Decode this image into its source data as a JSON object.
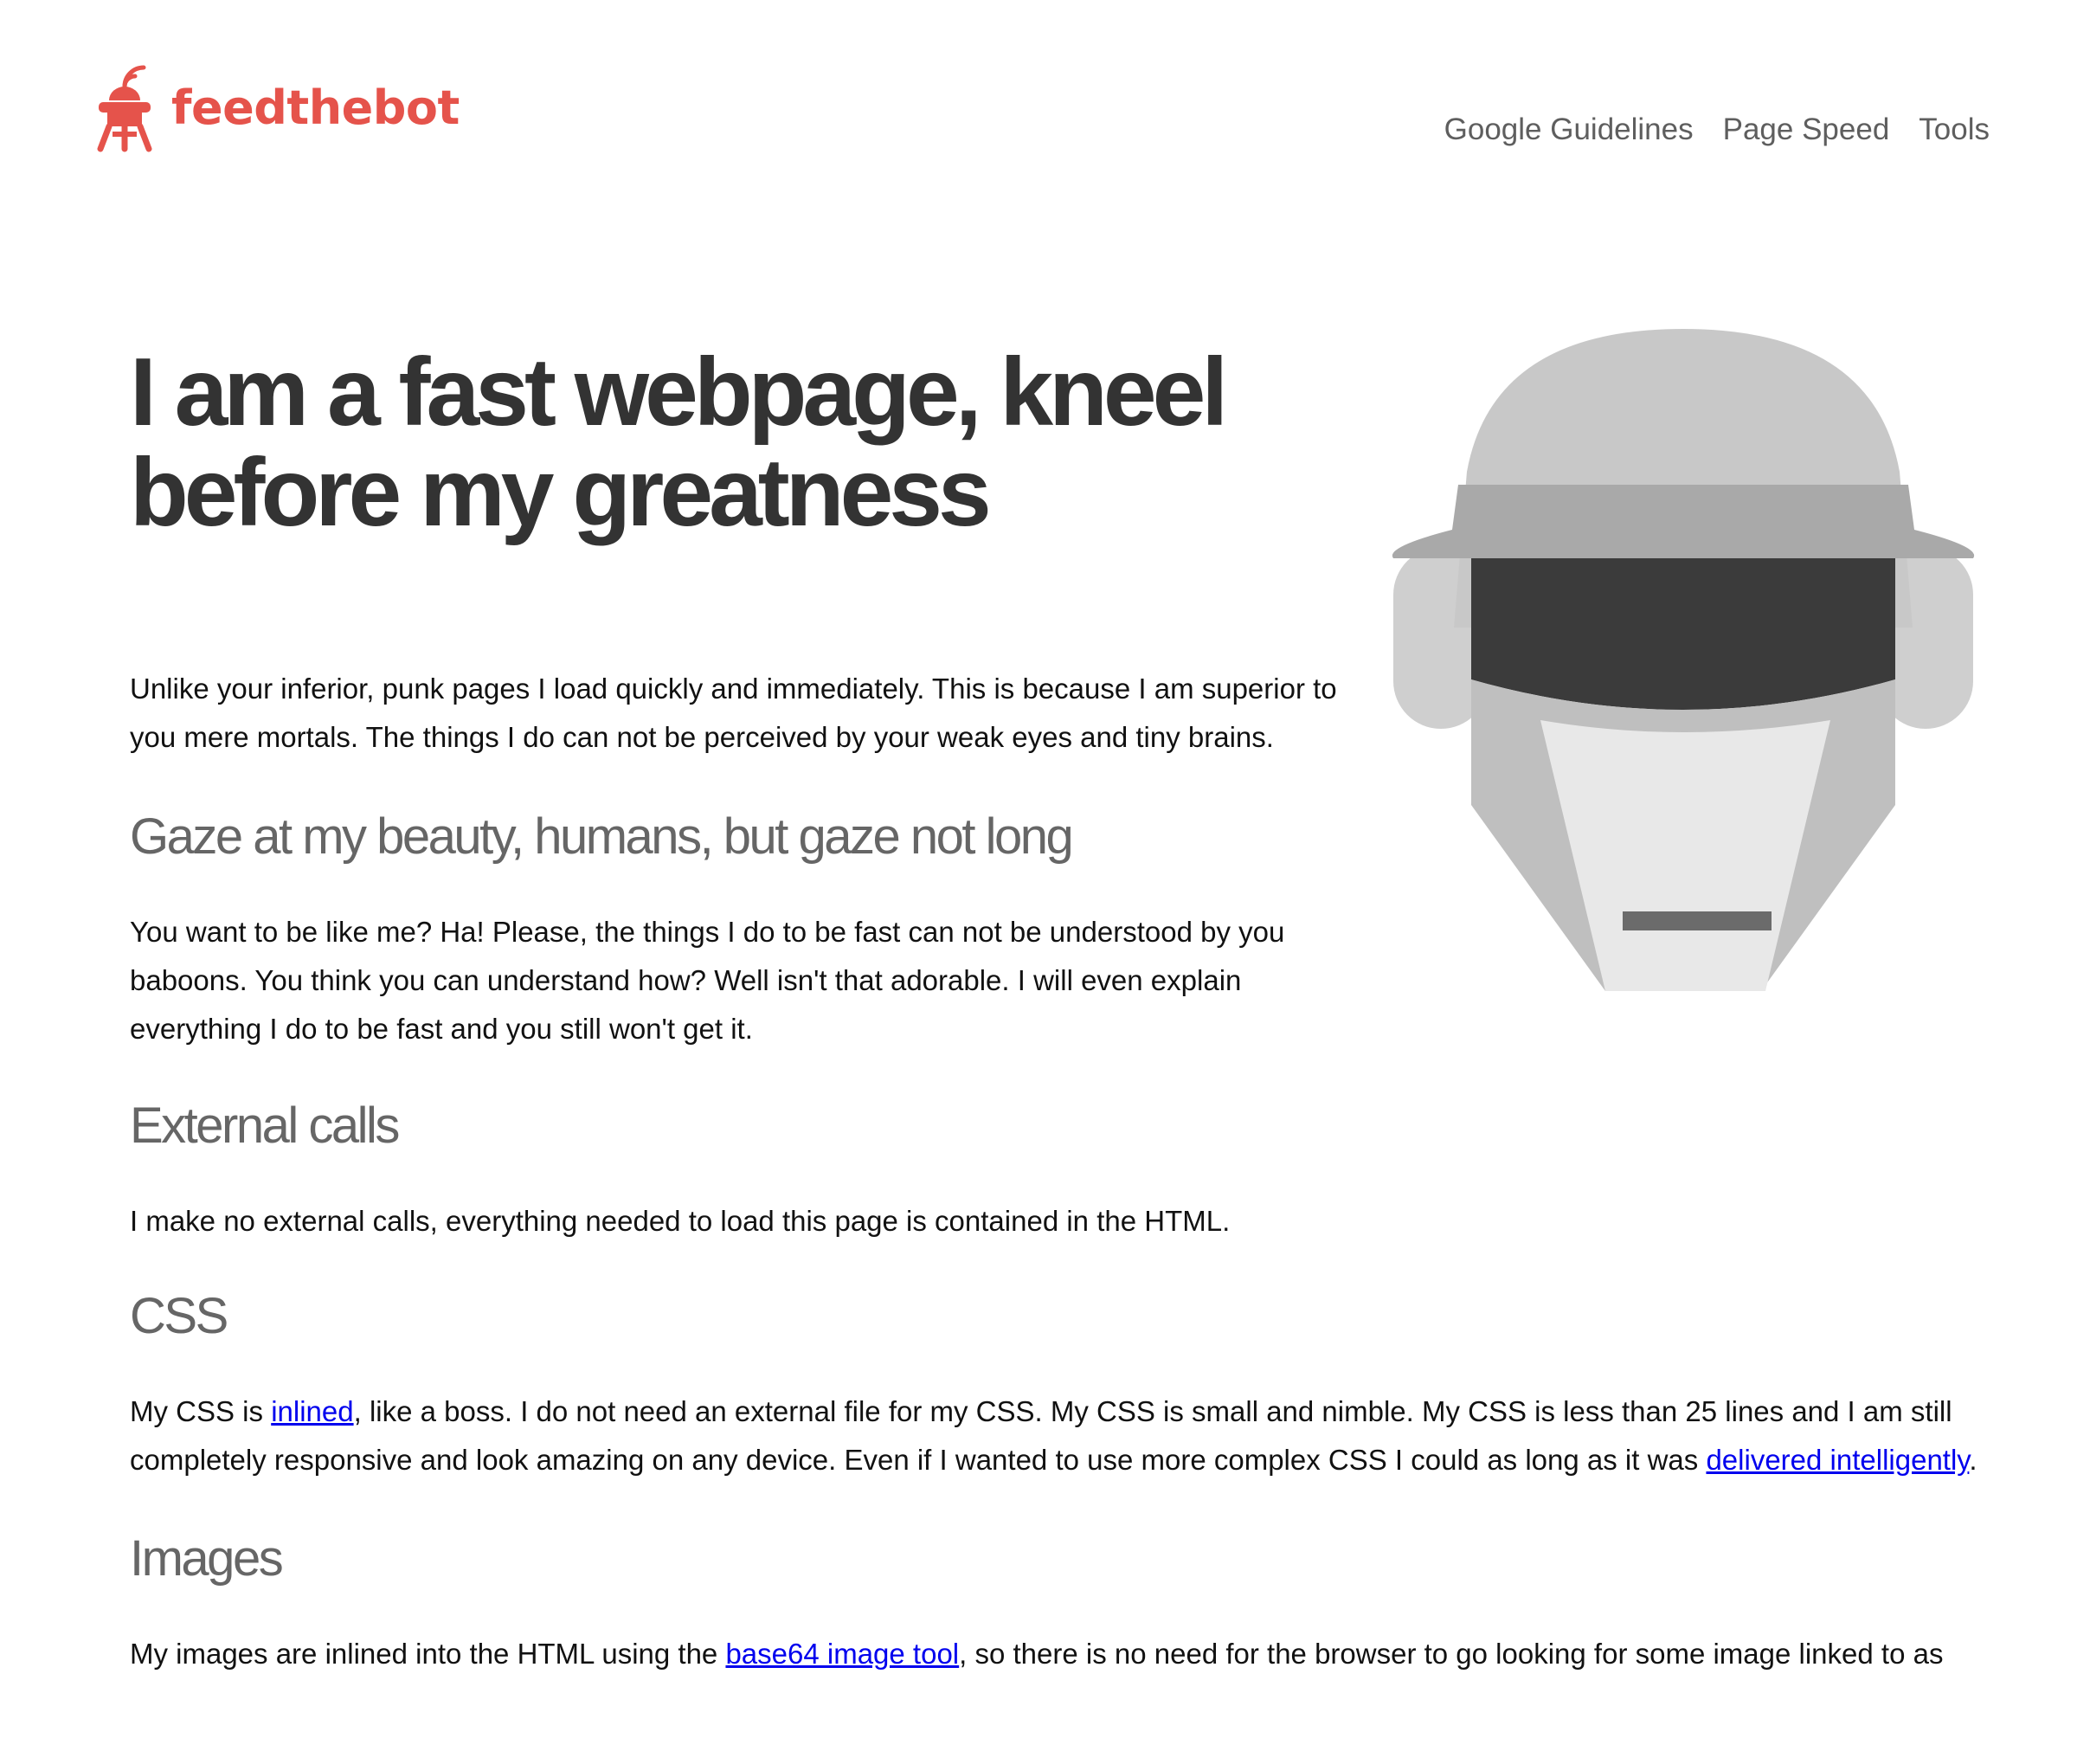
{
  "brand": {
    "name": "feedthebot"
  },
  "nav": {
    "items": [
      "Google Guidelines",
      "Page Speed",
      "Tools"
    ]
  },
  "hero": {
    "title": "I am a fast webpage, kneel before my greatness"
  },
  "intro": "Unlike your inferior, punk pages I load quickly and immediately. This is because I am superior to you mere mortals. The things I do can not be perceived by your weak eyes and tiny brains.",
  "gaze": {
    "heading": "Gaze at my beauty, humans, but gaze not long",
    "text": "You want to be like me? Ha! Please, the things I do to be fast can not be understood by you baboons. You think you can understand how? Well isn't that adorable. I will even explain everything I do to be fast and you still won't get it."
  },
  "external": {
    "heading": "External calls",
    "text": "I make no external calls, everything needed to load this page is contained in the HTML."
  },
  "css": {
    "heading": "CSS",
    "text1": "My CSS is ",
    "link1": "inlined",
    "text2": ", like a boss. I do not need an external file for my CSS. My CSS is small and nimble. My CSS is less than 25 lines and I am still completely responsive and look amazing on any device. Even if I wanted to use more complex CSS I could as long as it was ",
    "link2": "delivered intelligently",
    "text3": "."
  },
  "images": {
    "heading": "Images",
    "text1": "My images are inlined into the HTML using the ",
    "link1": "base64 image tool",
    "text2": ", so there is no need for the browser to go looking for some image linked to as"
  },
  "colors": {
    "brand": "#e5534b",
    "nav": "#5e5e5e",
    "title": "#333333",
    "subheading": "#666666",
    "link": "#0000ee"
  }
}
